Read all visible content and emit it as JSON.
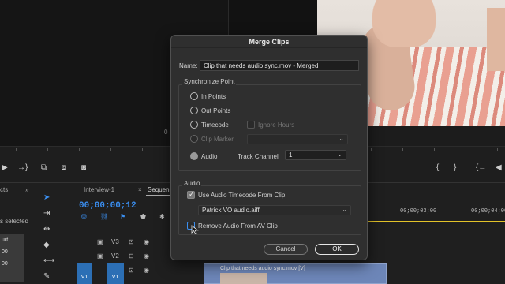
{
  "dialog": {
    "title": "Merge Clips",
    "name_label": "Name:",
    "name_value": "Clip that needs audio sync.mov - Merged",
    "sync_group_title": "Synchronize Point",
    "sync_options": {
      "in_points": "In Points",
      "out_points": "Out Points",
      "timecode": "Timecode",
      "ignore_hours": "Ignore Hours",
      "clip_marker": "Clip Marker",
      "audio": "Audio"
    },
    "track_channel_label": "Track Channel",
    "track_channel_value": "1",
    "audio_group_title": "Audio",
    "use_audio_timecode_label": "Use Audio Timecode From Clip:",
    "audio_clip_value": "Patrick VO audio.aiff",
    "remove_audio_label": "Remove Audio From AV Clip",
    "cancel_label": "Cancel",
    "ok_label": "OK"
  },
  "background": {
    "monitor_zero": "0",
    "tabs": [
      "Interview-1",
      "Sequen"
    ],
    "tab_close": "×",
    "timecode": "00;00;00;12",
    "selected_text": "s selected",
    "left_tab": "cts",
    "ruler_times": [
      "00;00;03;00",
      "00;00;04;00"
    ],
    "tracks": [
      "V3",
      "V2",
      "V1"
    ],
    "track_v1_label": "V1",
    "clip_name": "Clip that needs audio sync.mov [V]",
    "orange_box_items": [
      "urt",
      "00",
      "00"
    ]
  },
  "colors": {
    "accent": "#3b8ff0",
    "timecode": "#3a8ef0",
    "track_blue": "#2c6fb5",
    "clip": "#6d86b8",
    "playhead_yellow": "#e2c229"
  }
}
